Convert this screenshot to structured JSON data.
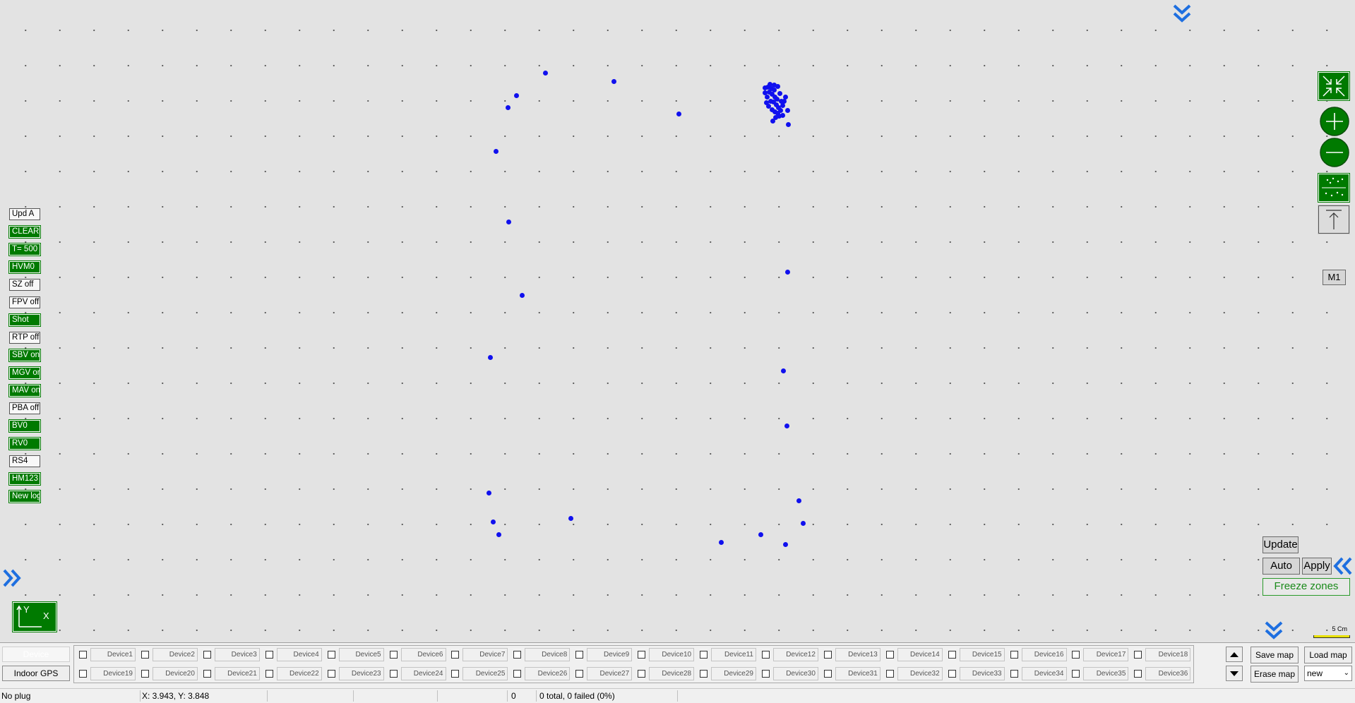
{
  "left_buttons": [
    {
      "label": "Upd A",
      "on": false
    },
    {
      "label": "CLEAR",
      "on": true
    },
    {
      "label": "T= 500",
      "on": true
    },
    {
      "label": "HVM0",
      "on": true
    },
    {
      "label": "SZ off",
      "on": false
    },
    {
      "label": "FPV off",
      "on": false
    },
    {
      "label": "Shot",
      "on": true
    },
    {
      "label": "RTP off",
      "on": false
    },
    {
      "label": "SBV on",
      "on": true
    },
    {
      "label": "MGV on",
      "on": true
    },
    {
      "label": "MAV on",
      "on": true
    },
    {
      "label": "PBA off",
      "on": false
    },
    {
      "label": "BV0",
      "on": true
    },
    {
      "label": "RV0",
      "on": true
    },
    {
      "label": "RS4",
      "on": false
    },
    {
      "label": "HM123",
      "on": true
    },
    {
      "label": "New log",
      "on": true
    }
  ],
  "right_panel": {
    "m1_label": "M1",
    "update_label": "Update",
    "auto_label": "Auto",
    "apply_label": "Apply",
    "freeze_label": "Freeze zones",
    "scale_label": "5 Cm"
  },
  "axis_icon": {
    "y": "Y",
    "x": "X"
  },
  "bottom_left": {
    "device_label": "Device",
    "indoor_gps_label": "Indoor GPS"
  },
  "devices": [
    "Device1",
    "Device2",
    "Device3",
    "Device4",
    "Device5",
    "Device6",
    "Device7",
    "Device8",
    "Device9",
    "Device10",
    "Device11",
    "Device12",
    "Device13",
    "Device14",
    "Device15",
    "Device16",
    "Device17",
    "Device18",
    "Device19",
    "Device20",
    "Device21",
    "Device22",
    "Device23",
    "Device24",
    "Device25",
    "Device26",
    "Device27",
    "Device28",
    "Device29",
    "Device30",
    "Device31",
    "Device32",
    "Device33",
    "Device34",
    "Device35",
    "Device36"
  ],
  "map_controls": {
    "save_map": "Save map",
    "load_map": "Load map",
    "erase_map": "Erase map",
    "map_select": "new"
  },
  "status": {
    "plug": "No plug",
    "coords": "X: 3.943, Y: 3.848",
    "count": "0",
    "summary": "0 total, 0 failed (0%)"
  },
  "colors": {
    "accent_green": "#007a00",
    "marker_blue": "#1010ee",
    "chevron_blue": "#1e6fe0"
  }
}
